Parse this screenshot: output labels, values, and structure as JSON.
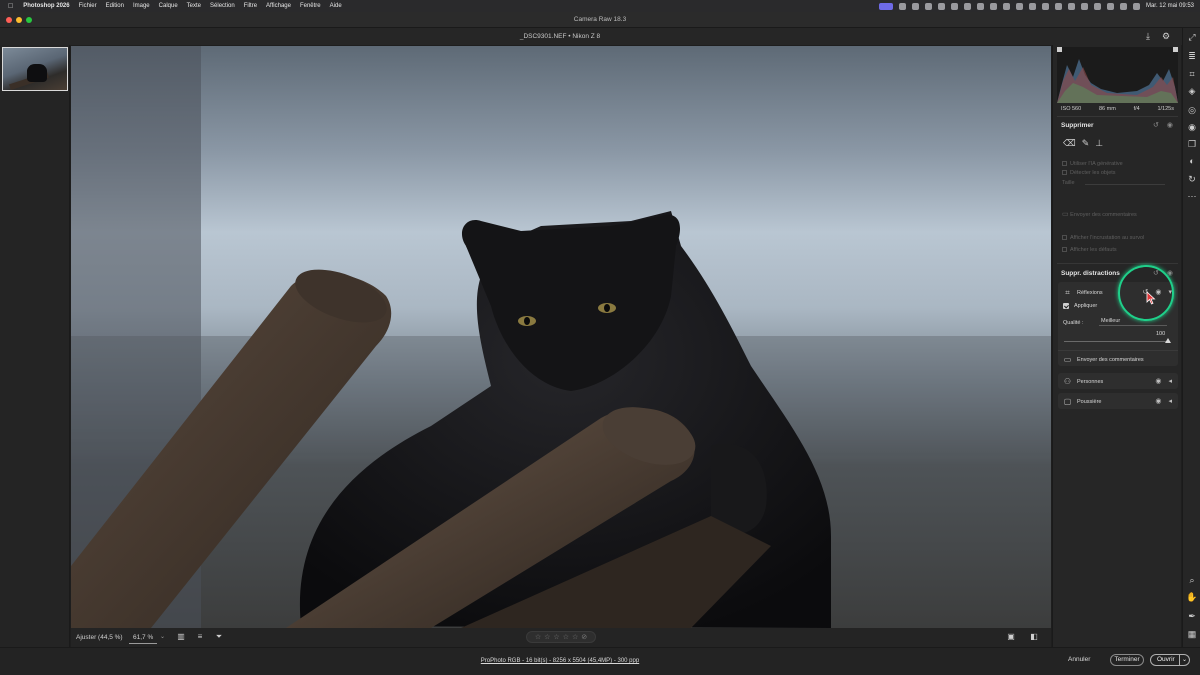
{
  "menubar": {
    "app_name": "Photoshop 2026",
    "items": [
      "Fichier",
      "Edition",
      "Image",
      "Calque",
      "Texte",
      "Sélection",
      "Filtre",
      "Affichage",
      "Fenêtre",
      "Aide"
    ],
    "clock": "Mar. 12 mai 09:53"
  },
  "window": {
    "title": "Camera Raw 18.3",
    "file_title": "_DSC9301.NEF  •  Nikon Z 8"
  },
  "panel": {
    "exif": [
      "ISO 560",
      "86 mm",
      "f/4",
      "1/125s"
    ],
    "supprimer": {
      "title": "Supprimer",
      "generative_ai": "Utiliser l'IA générative",
      "detect_objects": "Détecter les objets",
      "size_label": "Taille",
      "send_feedback": "Envoyer des commentaires",
      "show_overlay": "Afficher l'incrustation au survol",
      "show_defaults": "Afficher les défauts"
    },
    "distractions": {
      "title": "Suppr. distractions",
      "reflections": "Réflexions",
      "apply": "Appliquer",
      "quality_label": "Qualité :",
      "quality_value": "Meilleur",
      "slider_value": "100",
      "slider_fraction": 1.0,
      "send_feedback": "Envoyer des commentaires",
      "people": "Personnes",
      "dust": "Poussière"
    }
  },
  "view_toolbar": {
    "fit_label": "Ajuster (44,5 %)",
    "zoom_value": "61,7 %"
  },
  "statusbar": {
    "color_info": "ProPhoto RGB - 16 bit(s) - 8256 x 5504 (45,4MP) - 300 ppp",
    "cancel": "Annuler",
    "done": "Terminer",
    "open": "Ouvrir"
  },
  "colors": {
    "accent_ring": "#1fd08a",
    "cursor": "#e0383b"
  }
}
